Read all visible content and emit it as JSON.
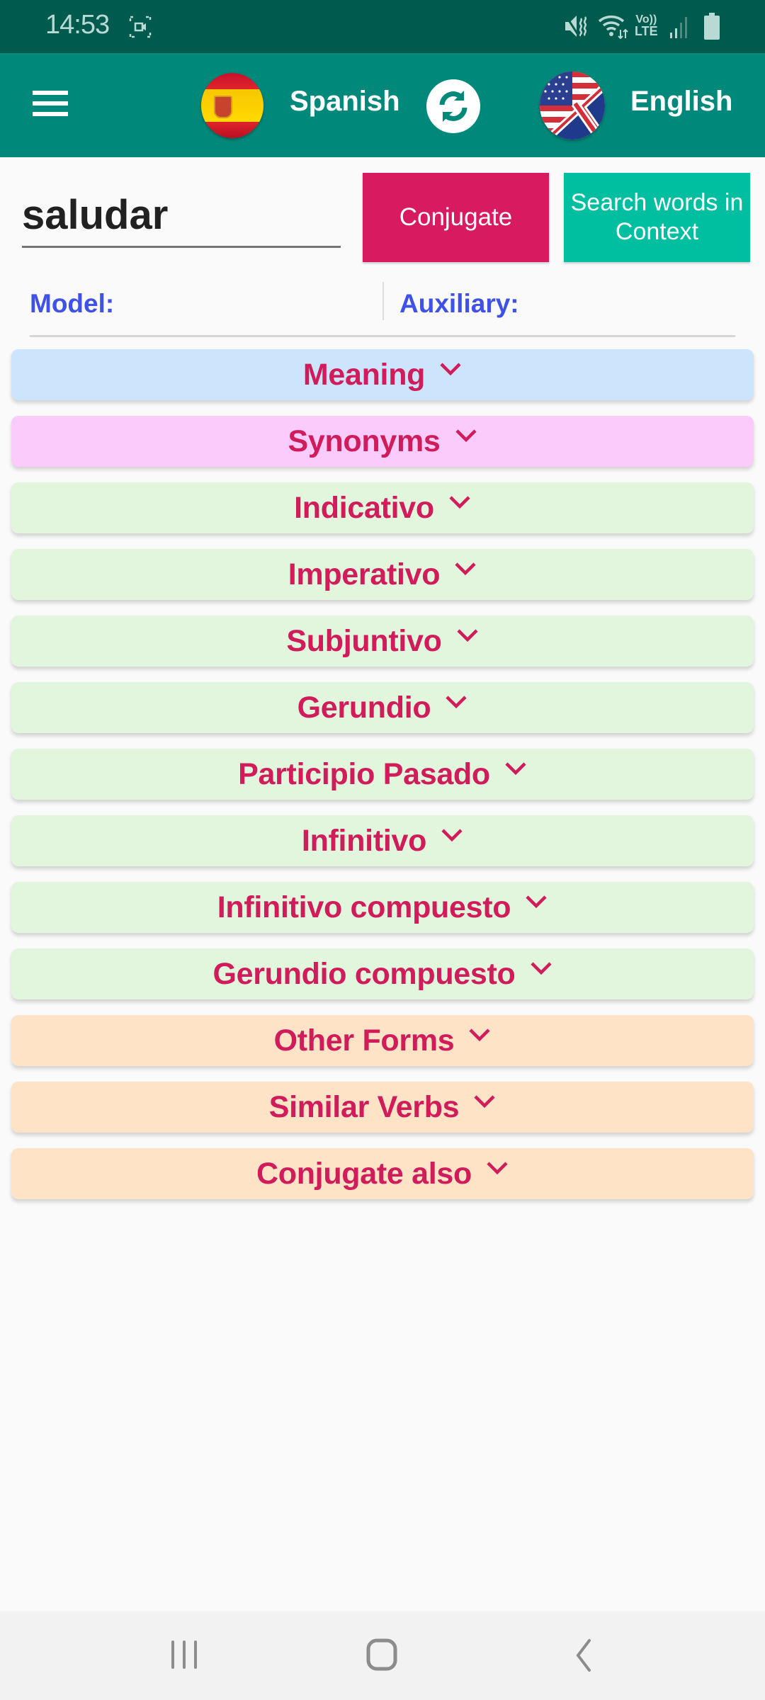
{
  "status_bar": {
    "time": "14:53",
    "icons": [
      "screen-record-icon",
      "mute-icon",
      "wifi-icon",
      "volte-lte-icon",
      "signal-icon",
      "battery-icon"
    ],
    "volte_label_top": "Vo))",
    "volte_label_bottom": "LTE"
  },
  "toolbar": {
    "menu_icon": "hamburger-menu-icon",
    "source_language": "Spanish",
    "target_language": "English",
    "swap_icon": "swap-languages-icon",
    "colors": {
      "status": "#005A4D",
      "toolbar": "#00897B"
    }
  },
  "search": {
    "value": "saludar",
    "placeholder": "",
    "conjugate_label": "Conjugate",
    "context_label": "Search words in Context",
    "colors": {
      "conjugate": "#D81B60",
      "context": "#00BFA0"
    }
  },
  "info": {
    "model_label": "Model:",
    "model_value": "",
    "auxiliary_label": "Auxiliary:",
    "auxiliary_value": ""
  },
  "sections": [
    {
      "label": "Meaning",
      "color": "#CCE4FC"
    },
    {
      "label": "Synonyms",
      "color": "#FBCCFB"
    },
    {
      "label": "Indicativo",
      "color": "#E2F5DD"
    },
    {
      "label": "Imperativo",
      "color": "#E2F5DD"
    },
    {
      "label": "Subjuntivo",
      "color": "#E2F5DD"
    },
    {
      "label": "Gerundio",
      "color": "#E2F5DD"
    },
    {
      "label": "Participio Pasado",
      "color": "#E2F5DD"
    },
    {
      "label": "Infinitivo",
      "color": "#E2F5DD"
    },
    {
      "label": "Infinitivo compuesto",
      "color": "#E2F5DD"
    },
    {
      "label": "Gerundio compuesto",
      "color": "#E2F5DD"
    },
    {
      "label": "Other Forms",
      "color": "#FFE3C6"
    },
    {
      "label": "Similar Verbs",
      "color": "#FFE3C6"
    },
    {
      "label": "Conjugate also",
      "color": "#FFE3C6"
    }
  ],
  "section_text_color": "#D01C5B",
  "nav_bar": {
    "buttons": [
      "recent-apps-icon",
      "home-icon",
      "back-icon"
    ]
  }
}
